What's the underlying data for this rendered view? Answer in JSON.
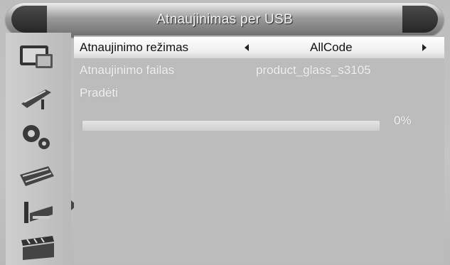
{
  "title": "Atnaujinimas per USB",
  "sidebar": {
    "icons": [
      {
        "name": "tv-picture-icon"
      },
      {
        "name": "satellite-dish-icon"
      },
      {
        "name": "gears-settings-icon"
      },
      {
        "name": "toolbox-icon"
      },
      {
        "name": "media-tools-icon"
      },
      {
        "name": "clapperboard-icon"
      }
    ]
  },
  "menu": {
    "mode_label": "Atnaujinimo režimas",
    "mode_value": "AllCode",
    "file_label": "Atnaujinimo failas",
    "file_value": "product_glass_s3105",
    "start_label": "Pradėti"
  },
  "progress": {
    "percent_text": "0%",
    "fraction": 0
  }
}
